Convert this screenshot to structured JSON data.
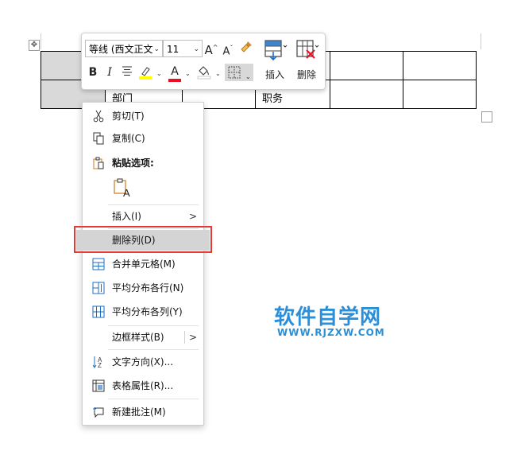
{
  "table": {
    "rows": [
      [
        "",
        "",
        "",
        "",
        "",
        ""
      ],
      [
        "",
        "部门",
        "",
        "职务",
        "",
        ""
      ]
    ]
  },
  "mini_toolbar": {
    "font_name": "等线 (西文正文",
    "font_size": "11",
    "grow_font": "A",
    "shrink_font": "A",
    "bold": "B",
    "italic": "I",
    "font_color_letter": "A",
    "insert_label": "插入",
    "delete_label": "删除",
    "colors": {
      "highlight": "#ffff00",
      "font_color": "#e81123",
      "accent": "#1e6fc4"
    }
  },
  "context_menu": {
    "items": [
      {
        "label": "剪切(T)",
        "icon": "scissors-icon"
      },
      {
        "label": "复制(C)",
        "icon": "copy-icon"
      },
      {
        "label": "粘贴选项:",
        "icon": "clipboard-icon"
      },
      {
        "label": "插入(I)",
        "icon": ""
      },
      {
        "label": "删除列(D)",
        "icon": ""
      },
      {
        "label": "合并单元格(M)",
        "icon": "merge-cells-icon"
      },
      {
        "label": "平均分布各行(N)",
        "icon": "distribute-rows-icon"
      },
      {
        "label": "平均分布各列(Y)",
        "icon": "distribute-columns-icon"
      },
      {
        "label": "边框样式(B)",
        "icon": ""
      },
      {
        "label": "文字方向(X)...",
        "icon": "text-direction-icon"
      },
      {
        "label": "表格属性(R)...",
        "icon": "table-properties-icon"
      },
      {
        "label": "新建批注(M)",
        "icon": "new-comment-icon"
      }
    ],
    "highlight_color": "#e53935"
  },
  "watermark": {
    "title": "软件自学网",
    "url": "WWW.RJZXW.COM",
    "color": "#2a8fd8"
  }
}
